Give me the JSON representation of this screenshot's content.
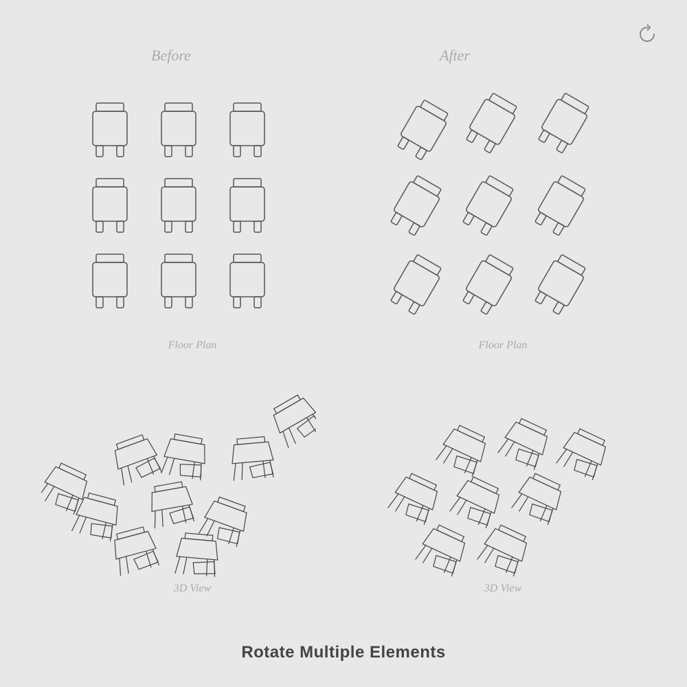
{
  "labels": {
    "before": "Before",
    "after": "After",
    "floor_plan_1": "Floor Plan",
    "floor_plan_2": "Floor Plan",
    "view_3d_1": "3D View",
    "view_3d_2": "3D View",
    "title": "Rotate Multiple Elements"
  },
  "icons": {
    "reload": "↺"
  }
}
